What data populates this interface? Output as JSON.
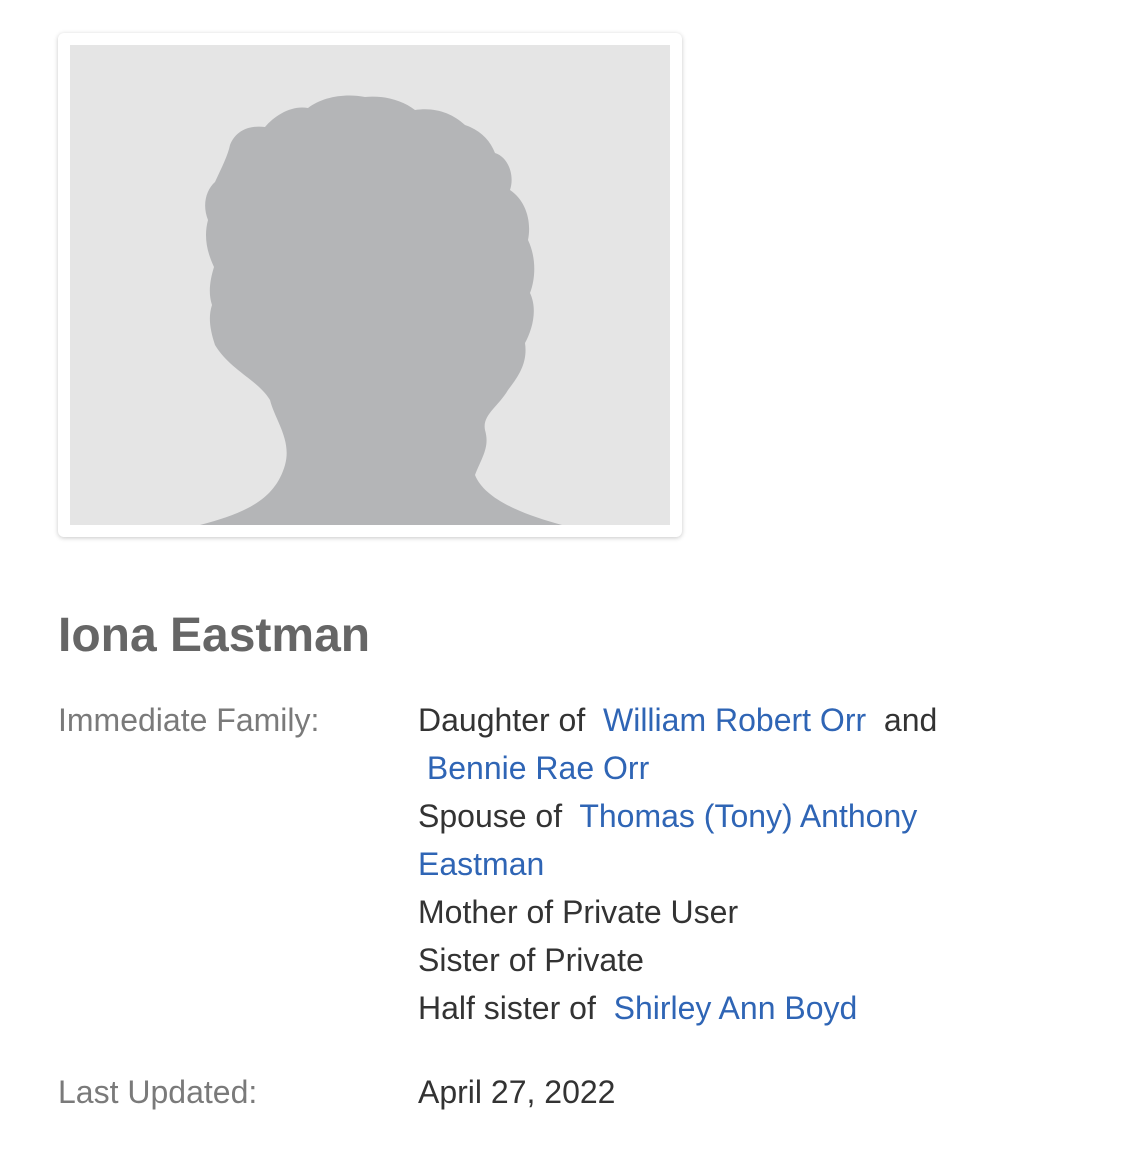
{
  "profile": {
    "name": "Iona Eastman",
    "photo_icon": "female-silhouette-placeholder",
    "photo_bg_color": "#e5e5e5",
    "silhouette_color": "#b4b5b7"
  },
  "details": {
    "family_label": "Immediate Family:",
    "updated_label": "Last Updated:",
    "last_updated": "April 27, 2022",
    "link_color": "#2f65b5"
  },
  "family": {
    "daughter_prefix": "Daughter of",
    "father": "William Robert Orr",
    "and_word": "and",
    "mother": "Bennie Rae Orr",
    "spouse_prefix": "Spouse of",
    "spouse": "Thomas (Tony) Anthony Eastman",
    "mother_of": "Mother of Private User",
    "sister_of": "Sister of Private",
    "half_sister_prefix": "Half sister of",
    "half_sister": "Shirley Ann Boyd"
  }
}
